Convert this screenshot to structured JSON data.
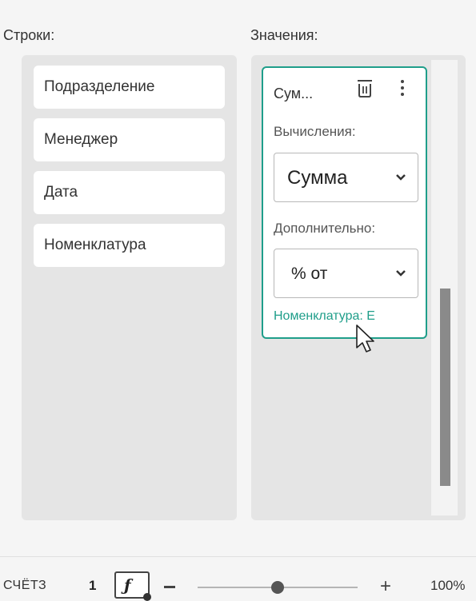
{
  "rows_panel": {
    "title": "Строки:",
    "items": [
      {
        "label": "Подразделение"
      },
      {
        "label": "Менеджер"
      },
      {
        "label": "Дата"
      },
      {
        "label": "Номенклатура"
      }
    ]
  },
  "values_panel": {
    "title": "Значения:",
    "card": {
      "title": "Сум...",
      "calc_label": "Вычисления:",
      "calc_value": "Сумма",
      "extra_label": "Дополнительно:",
      "extra_value": "% от",
      "footer": "Номенклатура: Е"
    }
  },
  "status_bar": {
    "label": "СЧЁТЗ",
    "value": "1",
    "formula_icon": "ƒ",
    "zoom_out": "−",
    "zoom_in": "+",
    "zoom_level": 0.5,
    "zoom_text": "100%"
  },
  "colors": {
    "accent": "#1f9e8a",
    "panel": "#e5e5e5",
    "scroll_thumb": "#8a8a8a"
  },
  "icons": {
    "trash": "trash-icon",
    "more": "more-vertical-icon",
    "chevron": "chevron-down-icon",
    "cursor": "mouse-cursor-icon",
    "formula": "formula-icon"
  }
}
